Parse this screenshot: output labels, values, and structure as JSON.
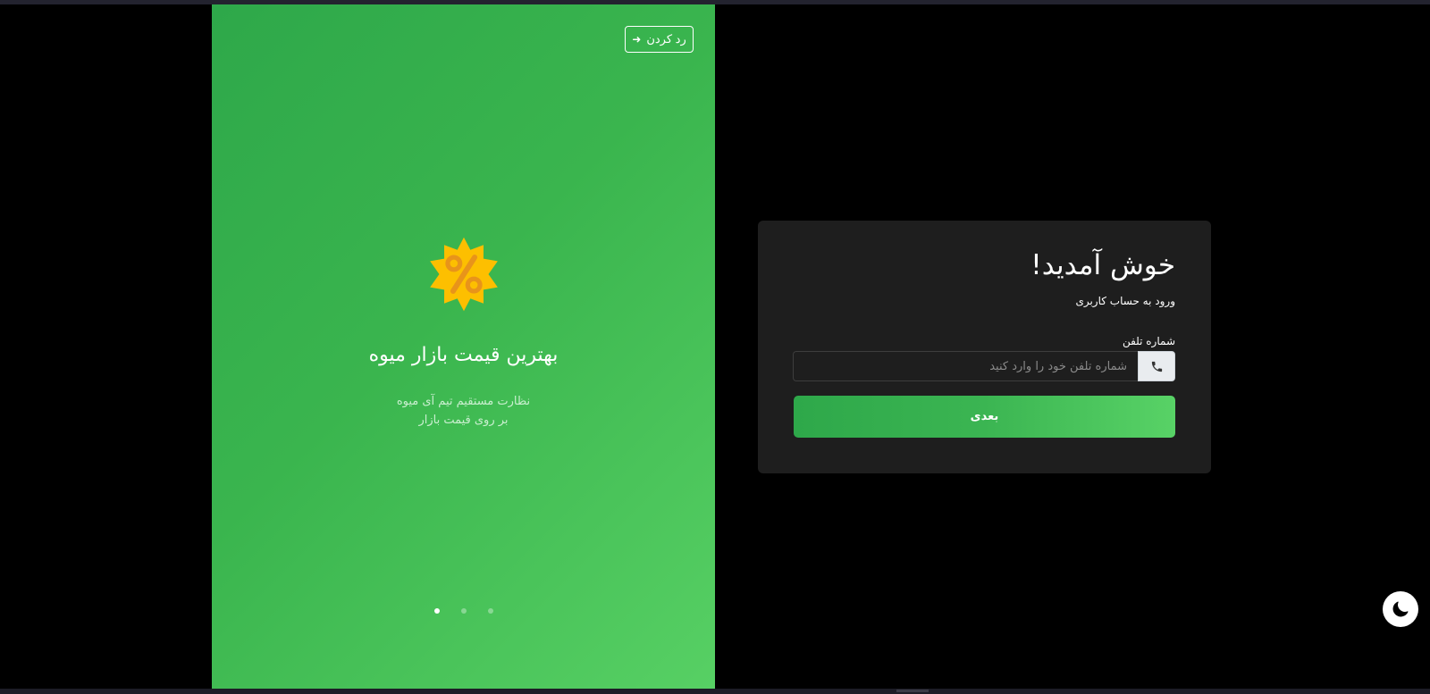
{
  "slide": {
    "skip_label": "رد کردن",
    "title": "بهترین قیمت بازار میوه",
    "description_line1": "نظارت مستقیم تیم آی میوه",
    "description_line2": "بر روی قیمت بازار",
    "dots_count": 3,
    "active_dot_index": 0,
    "badge_icon": "discount-percent-badge-icon",
    "badge_color": "#FDBF00",
    "background_start": "#2EA84A",
    "background_end": "#57D064"
  },
  "login": {
    "title": "خوش آمدید!",
    "subtitle": "ورود به حساب کاربری",
    "phone_label": "شماره تلفن",
    "phone_placeholder": "شماره تلفن خود را وارد کنید",
    "phone_value": "",
    "phone_icon": "phone-icon",
    "next_label": "بعدی",
    "card_color": "#1E1E1E",
    "accent_color": "#3BB552"
  },
  "theme_toggle": {
    "icon": "moon-icon"
  }
}
